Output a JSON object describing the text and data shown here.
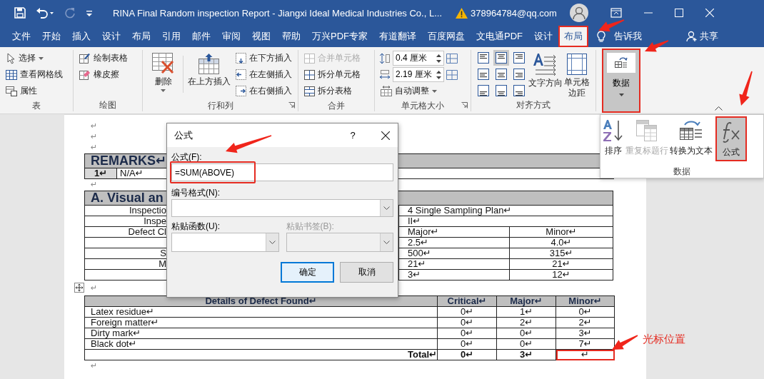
{
  "title_bar": {
    "title": "RINA Final Random inspection Report - Jiangxi Ideal Medical Industries Co., L...",
    "account": "378964784@qq.com"
  },
  "menu_tabs": [
    {
      "label": "文件",
      "selected": false,
      "highlighted": false
    },
    {
      "label": "开始",
      "selected": false,
      "highlighted": false
    },
    {
      "label": "插入",
      "selected": false,
      "highlighted": false
    },
    {
      "label": "设计",
      "selected": false,
      "highlighted": false
    },
    {
      "label": "布局",
      "selected": false,
      "highlighted": false
    },
    {
      "label": "引用",
      "selected": false,
      "highlighted": false
    },
    {
      "label": "邮件",
      "selected": false,
      "highlighted": false
    },
    {
      "label": "审阅",
      "selected": false,
      "highlighted": false
    },
    {
      "label": "视图",
      "selected": false,
      "highlighted": false
    },
    {
      "label": "帮助",
      "selected": false,
      "highlighted": false
    },
    {
      "label": "万兴PDF专家",
      "selected": false,
      "highlighted": false
    },
    {
      "label": "有道翻译",
      "selected": false,
      "highlighted": false
    },
    {
      "label": "百度网盘",
      "selected": false,
      "highlighted": false
    },
    {
      "label": "文电通PDF",
      "selected": false,
      "highlighted": false
    },
    {
      "label": "设计",
      "selected": false,
      "highlighted": false
    },
    {
      "label": "布局",
      "selected": true,
      "highlighted": true
    }
  ],
  "tell_me": "告诉我",
  "share": "共享",
  "ribbon": {
    "table": {
      "label": "表",
      "items": [
        {
          "label": "选择",
          "dropdown": true
        },
        {
          "label": "查看网格线",
          "dropdown": false
        },
        {
          "label": "属性",
          "dropdown": false
        }
      ]
    },
    "draw": {
      "label": "绘图",
      "items": [
        {
          "label": "绘制表格"
        },
        {
          "label": "橡皮擦"
        }
      ]
    },
    "rows_columns": {
      "label": "行和列",
      "delete": "删除",
      "insert_above": "在上方插入",
      "items": [
        {
          "label": "在下方插入"
        },
        {
          "label": "在左侧插入"
        },
        {
          "label": "在右侧插入"
        }
      ]
    },
    "merge": {
      "label": "合并",
      "items": [
        {
          "label": "合并单元格",
          "disabled": true
        },
        {
          "label": "拆分单元格",
          "disabled": false
        },
        {
          "label": "拆分表格",
          "disabled": false
        }
      ]
    },
    "cell_size": {
      "label": "单元格大小",
      "height": "0.4 厘米",
      "width": "2.19 厘米",
      "autofit": "自动调整"
    },
    "alignment": {
      "label": "对齐方式",
      "buttons": [
        {
          "selected": false
        },
        {
          "selected": true
        },
        {
          "selected": false
        },
        {
          "selected": false
        },
        {
          "selected": false
        },
        {
          "selected": false
        },
        {
          "selected": false
        },
        {
          "selected": false
        },
        {
          "selected": false
        }
      ],
      "text_direction": "文字方向",
      "cell_margins": "单元格边距"
    },
    "data": {
      "label": "数据",
      "selected": true,
      "highlighted": true
    }
  },
  "data_menu": {
    "label": "数据",
    "items": [
      {
        "label": "排序",
        "disabled": false,
        "selected": false,
        "highlighted": false
      },
      {
        "label": "重复标题行",
        "disabled": true,
        "selected": false,
        "highlighted": false
      },
      {
        "label": "转换为文本",
        "disabled": false,
        "selected": false,
        "highlighted": false
      },
      {
        "label": "公式",
        "disabled": false,
        "selected": true,
        "highlighted": true
      }
    ]
  },
  "document": {
    "blocks": [
      {
        "kind": "paragraph",
        "text": "↵",
        "table_handle": false
      },
      {
        "kind": "paragraph",
        "text": "↵",
        "table_handle": false
      },
      {
        "kind": "paragraph",
        "text": "↵",
        "table_handle": false
      },
      {
        "kind": "remarks",
        "title": "REMARKS↵",
        "rows": [
          {
            "number": "1↵",
            "text": "N/A↵"
          }
        ]
      },
      {
        "kind": "paragraph",
        "text": "↵",
        "table_handle": false
      },
      {
        "kind": "visual",
        "title": "A. Visual an",
        "rows": [
          {
            "kind": "span",
            "label": "Inspectio",
            "value": "4 Single Sampling Plan↵"
          },
          {
            "kind": "span",
            "label": "Inspe",
            "value": "II↵"
          },
          {
            "kind": "split",
            "label": "Defect Cl",
            "major": "Major↵",
            "minor": "Minor↵"
          },
          {
            "kind": "split",
            "major": "2.5↵",
            "minor": "4.0↵"
          },
          {
            "kind": "split",
            "label": "S",
            "major": "500↵",
            "minor": "315↵"
          },
          {
            "kind": "split",
            "label": "M",
            "major": "21↵",
            "minor": "21↵"
          },
          {
            "kind": "split",
            "major": "3↵",
            "minor": "12↵"
          }
        ]
      },
      {
        "kind": "paragraph",
        "text": "↵",
        "table_handle": true
      },
      {
        "kind": "defects",
        "columns": [
          "Details of Defect Found↵",
          "Critical↵",
          "Major↵",
          "Minor↵"
        ],
        "rows": [
          {
            "cells": [
              {
                "text": "Latex residue↵",
                "highlighted": false
              },
              {
                "text": "0↵",
                "highlighted": false
              },
              {
                "text": "1↵",
                "highlighted": false
              },
              {
                "text": "0↵",
                "highlighted": false
              }
            ]
          },
          {
            "cells": [
              {
                "text": "Foreign matter↵",
                "highlighted": false
              },
              {
                "text": "0↵",
                "highlighted": false
              },
              {
                "text": "2↵",
                "highlighted": false
              },
              {
                "text": "2↵",
                "highlighted": false
              }
            ]
          },
          {
            "cells": [
              {
                "text": "Dirty mark↵",
                "highlighted": false
              },
              {
                "text": "0↵",
                "highlighted": false
              },
              {
                "text": "0↵",
                "highlighted": false
              },
              {
                "text": "3↵",
                "highlighted": false
              }
            ]
          },
          {
            "cells": [
              {
                "text": "Black dot↵",
                "highlighted": false
              },
              {
                "text": "0↵",
                "highlighted": false
              },
              {
                "text": "0↵",
                "highlighted": false
              },
              {
                "text": "7↵",
                "highlighted": false
              }
            ]
          },
          {
            "cells": [
              {
                "text": "Total↵",
                "highlighted": false
              },
              {
                "text": "0↵",
                "highlighted": false
              },
              {
                "text": "3↵",
                "highlighted": false
              },
              {
                "text": "↵",
                "highlighted": true
              }
            ],
            "total": true
          }
        ]
      },
      {
        "kind": "paragraph",
        "text": "↵",
        "table_handle": false
      }
    ]
  },
  "dialog": {
    "title": "公式",
    "help": "?",
    "formula": {
      "label": "公式(F):",
      "value": "=SUM(ABOVE)",
      "highlighted": true
    },
    "number_format": {
      "label": "编号格式(N):"
    },
    "paste_function": {
      "label": "粘贴函数(U):",
      "disabled": false
    },
    "paste_bookmark": {
      "label": "粘贴书签(B):",
      "disabled": true
    },
    "buttons": [
      {
        "label": "确定",
        "default": true
      },
      {
        "label": "取消",
        "default": false
      }
    ]
  },
  "annotation": {
    "text": "光标位置"
  }
}
